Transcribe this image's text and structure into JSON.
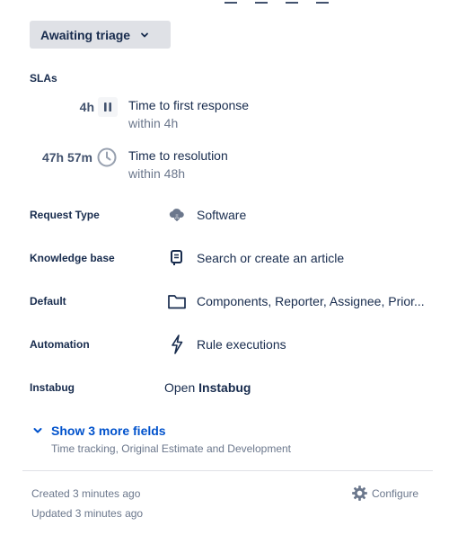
{
  "status": {
    "label": "Awaiting triage"
  },
  "slas": {
    "heading": "SLAs",
    "items": [
      {
        "time": "4h",
        "title": "Time to first response",
        "sub": "within 4h"
      },
      {
        "time": "47h 57m",
        "title": "Time to resolution",
        "sub": "within 48h"
      }
    ]
  },
  "fields": {
    "request_type": {
      "label": "Request Type",
      "value": "Software"
    },
    "knowledge_base": {
      "label": "Knowledge base",
      "value": "Search or create an article"
    },
    "default": {
      "label": "Default",
      "value": "Components, Reporter, Assignee, Prior..."
    },
    "automation": {
      "label": "Automation",
      "value": "Rule executions"
    },
    "instabug": {
      "label": "Instabug",
      "prefix": "Open",
      "value": "Instabug"
    }
  },
  "more_fields": {
    "label": "Show 3 more fields",
    "sub": "Time tracking, Original Estimate and Development"
  },
  "footer": {
    "created": "Created 3 minutes ago",
    "updated": "Updated 3 minutes ago",
    "configure": "Configure"
  }
}
